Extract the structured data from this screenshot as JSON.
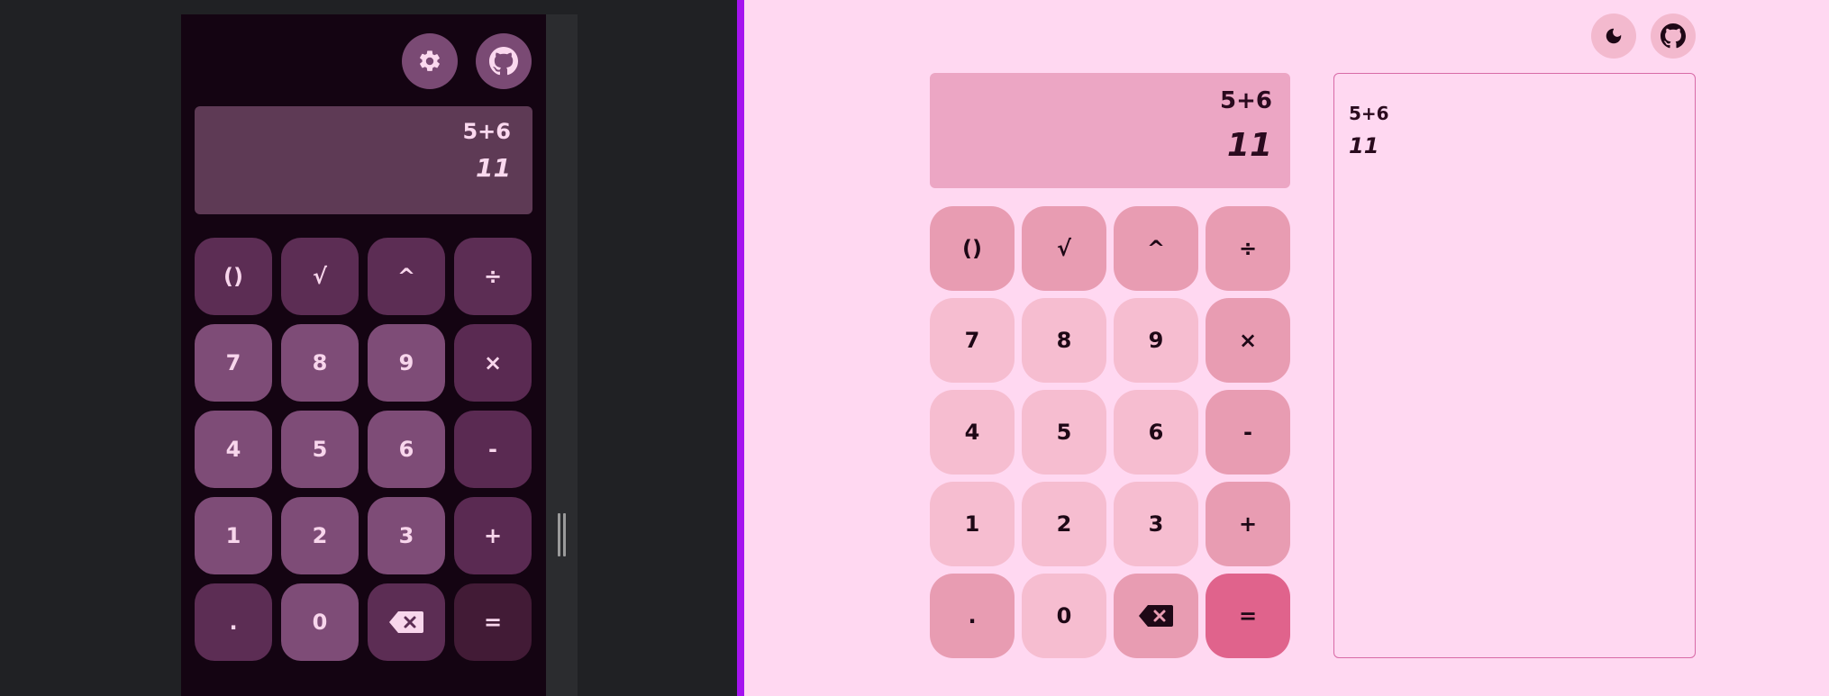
{
  "colors": {
    "dark_background": "#140412",
    "light_background": "#ffd8f1",
    "divider_accent": "#a513ef",
    "equals_light": "#e0638c"
  },
  "dark_app": {
    "header": {
      "settings_icon": "gear-icon",
      "github_icon": "github-icon"
    },
    "display": {
      "expression": "5+6",
      "result": "11"
    },
    "keys": [
      "()",
      "√",
      "^",
      "÷",
      "7",
      "8",
      "9",
      "×",
      "4",
      "5",
      "6",
      "-",
      "1",
      "2",
      "3",
      "+",
      ".",
      "0",
      "⌫",
      "="
    ]
  },
  "light_app": {
    "header": {
      "theme_icon": "moon-icon",
      "github_icon": "github-icon"
    },
    "display": {
      "expression": "5+6",
      "result": "11"
    },
    "keys": [
      "()",
      "√",
      "^",
      "÷",
      "7",
      "8",
      "9",
      "×",
      "4",
      "5",
      "6",
      "-",
      "1",
      "2",
      "3",
      "+",
      ".",
      "0",
      "⌫",
      "="
    ],
    "history": {
      "expression": "5+6",
      "result": "11"
    }
  }
}
